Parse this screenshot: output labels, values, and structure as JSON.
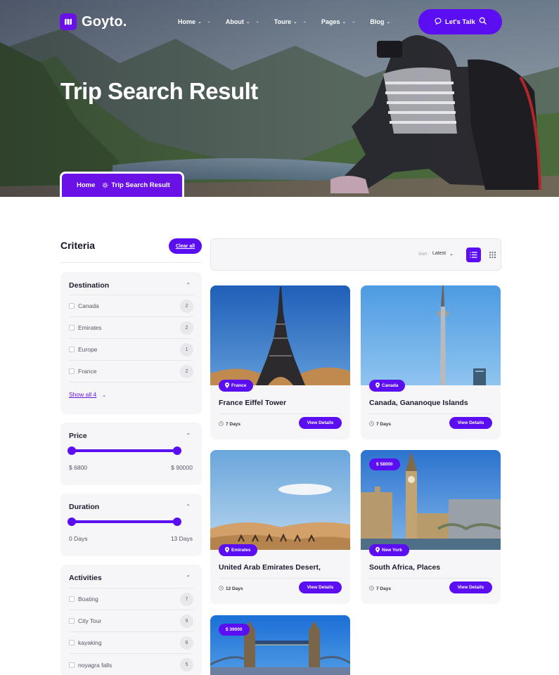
{
  "header": {
    "brand": "Goyto.",
    "nav": [
      {
        "label": "Home"
      },
      {
        "label": "About"
      },
      {
        "label": "Toure"
      },
      {
        "label": "Pages"
      },
      {
        "label": "Blog"
      }
    ],
    "cta_label": "Let's Talk"
  },
  "hero": {
    "title": "Trip Search Result",
    "breadcrumb": {
      "home": "Home",
      "current": "Trip Search Result"
    }
  },
  "sidebar": {
    "title": "Criteria",
    "clear_label": "Clear all",
    "destination": {
      "title": "Destination",
      "options": [
        {
          "label": "Canada",
          "count": "2"
        },
        {
          "label": "Emirates",
          "count": "2"
        },
        {
          "label": "Europe",
          "count": "1"
        },
        {
          "label": "France",
          "count": "2"
        }
      ],
      "show_all": "Show all 4"
    },
    "price": {
      "title": "Price",
      "min_label": "$ 6800",
      "max_label": "$ 90000"
    },
    "duration": {
      "title": "Duration",
      "min_label": "0 Days",
      "max_label": "13 Days"
    },
    "activities": {
      "title": "Activities",
      "options": [
        {
          "label": "Boating",
          "count": "7"
        },
        {
          "label": "City Tour",
          "count": "9"
        },
        {
          "label": "kayaking",
          "count": "8"
        },
        {
          "label": "noyagra falls",
          "count": "5"
        }
      ]
    }
  },
  "toolbar": {
    "sort_label": "Sort :",
    "sort_value": "Latest"
  },
  "trips": [
    {
      "location": "France",
      "title": "France Eiffel Tower",
      "duration": "7 Days",
      "button": "View Details"
    },
    {
      "location": "Canada",
      "title": "Canada, Gananoque Islands",
      "duration": "7 Days",
      "button": "View Details"
    },
    {
      "location": "Emirates",
      "title": "United Arab Emirates Desert,",
      "duration": "12 Days",
      "button": "View Details"
    },
    {
      "location": "New York",
      "title": "South Africa, Places",
      "duration": "7 Days",
      "price": "$ 58000",
      "button": "View Details"
    },
    {
      "price": "$ 39000"
    }
  ],
  "colors": {
    "accent": "#5b0ef2",
    "panel_bg": "#f6f6f8"
  }
}
